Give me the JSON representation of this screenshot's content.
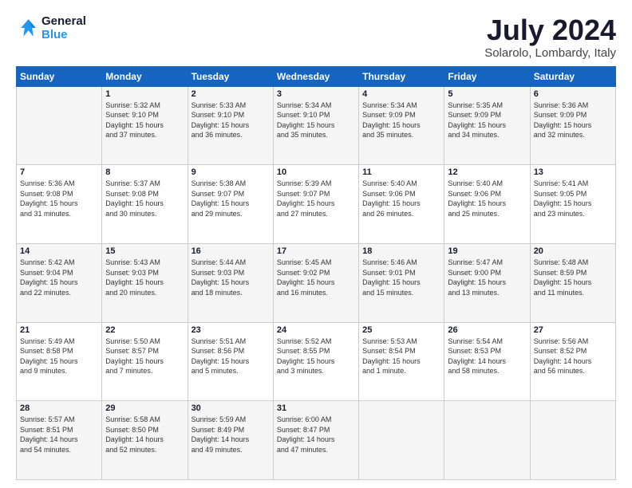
{
  "logo": {
    "line1": "General",
    "line2": "Blue"
  },
  "title": "July 2024",
  "subtitle": "Solarolo, Lombardy, Italy",
  "header_days": [
    "Sunday",
    "Monday",
    "Tuesday",
    "Wednesday",
    "Thursday",
    "Friday",
    "Saturday"
  ],
  "weeks": [
    [
      {
        "day": "",
        "info": ""
      },
      {
        "day": "1",
        "info": "Sunrise: 5:32 AM\nSunset: 9:10 PM\nDaylight: 15 hours\nand 37 minutes."
      },
      {
        "day": "2",
        "info": "Sunrise: 5:33 AM\nSunset: 9:10 PM\nDaylight: 15 hours\nand 36 minutes."
      },
      {
        "day": "3",
        "info": "Sunrise: 5:34 AM\nSunset: 9:10 PM\nDaylight: 15 hours\nand 35 minutes."
      },
      {
        "day": "4",
        "info": "Sunrise: 5:34 AM\nSunset: 9:09 PM\nDaylight: 15 hours\nand 35 minutes."
      },
      {
        "day": "5",
        "info": "Sunrise: 5:35 AM\nSunset: 9:09 PM\nDaylight: 15 hours\nand 34 minutes."
      },
      {
        "day": "6",
        "info": "Sunrise: 5:36 AM\nSunset: 9:09 PM\nDaylight: 15 hours\nand 32 minutes."
      }
    ],
    [
      {
        "day": "7",
        "info": "Sunrise: 5:36 AM\nSunset: 9:08 PM\nDaylight: 15 hours\nand 31 minutes."
      },
      {
        "day": "8",
        "info": "Sunrise: 5:37 AM\nSunset: 9:08 PM\nDaylight: 15 hours\nand 30 minutes."
      },
      {
        "day": "9",
        "info": "Sunrise: 5:38 AM\nSunset: 9:07 PM\nDaylight: 15 hours\nand 29 minutes."
      },
      {
        "day": "10",
        "info": "Sunrise: 5:39 AM\nSunset: 9:07 PM\nDaylight: 15 hours\nand 27 minutes."
      },
      {
        "day": "11",
        "info": "Sunrise: 5:40 AM\nSunset: 9:06 PM\nDaylight: 15 hours\nand 26 minutes."
      },
      {
        "day": "12",
        "info": "Sunrise: 5:40 AM\nSunset: 9:06 PM\nDaylight: 15 hours\nand 25 minutes."
      },
      {
        "day": "13",
        "info": "Sunrise: 5:41 AM\nSunset: 9:05 PM\nDaylight: 15 hours\nand 23 minutes."
      }
    ],
    [
      {
        "day": "14",
        "info": "Sunrise: 5:42 AM\nSunset: 9:04 PM\nDaylight: 15 hours\nand 22 minutes."
      },
      {
        "day": "15",
        "info": "Sunrise: 5:43 AM\nSunset: 9:03 PM\nDaylight: 15 hours\nand 20 minutes."
      },
      {
        "day": "16",
        "info": "Sunrise: 5:44 AM\nSunset: 9:03 PM\nDaylight: 15 hours\nand 18 minutes."
      },
      {
        "day": "17",
        "info": "Sunrise: 5:45 AM\nSunset: 9:02 PM\nDaylight: 15 hours\nand 16 minutes."
      },
      {
        "day": "18",
        "info": "Sunrise: 5:46 AM\nSunset: 9:01 PM\nDaylight: 15 hours\nand 15 minutes."
      },
      {
        "day": "19",
        "info": "Sunrise: 5:47 AM\nSunset: 9:00 PM\nDaylight: 15 hours\nand 13 minutes."
      },
      {
        "day": "20",
        "info": "Sunrise: 5:48 AM\nSunset: 8:59 PM\nDaylight: 15 hours\nand 11 minutes."
      }
    ],
    [
      {
        "day": "21",
        "info": "Sunrise: 5:49 AM\nSunset: 8:58 PM\nDaylight: 15 hours\nand 9 minutes."
      },
      {
        "day": "22",
        "info": "Sunrise: 5:50 AM\nSunset: 8:57 PM\nDaylight: 15 hours\nand 7 minutes."
      },
      {
        "day": "23",
        "info": "Sunrise: 5:51 AM\nSunset: 8:56 PM\nDaylight: 15 hours\nand 5 minutes."
      },
      {
        "day": "24",
        "info": "Sunrise: 5:52 AM\nSunset: 8:55 PM\nDaylight: 15 hours\nand 3 minutes."
      },
      {
        "day": "25",
        "info": "Sunrise: 5:53 AM\nSunset: 8:54 PM\nDaylight: 15 hours\nand 1 minute."
      },
      {
        "day": "26",
        "info": "Sunrise: 5:54 AM\nSunset: 8:53 PM\nDaylight: 14 hours\nand 58 minutes."
      },
      {
        "day": "27",
        "info": "Sunrise: 5:56 AM\nSunset: 8:52 PM\nDaylight: 14 hours\nand 56 minutes."
      }
    ],
    [
      {
        "day": "28",
        "info": "Sunrise: 5:57 AM\nSunset: 8:51 PM\nDaylight: 14 hours\nand 54 minutes."
      },
      {
        "day": "29",
        "info": "Sunrise: 5:58 AM\nSunset: 8:50 PM\nDaylight: 14 hours\nand 52 minutes."
      },
      {
        "day": "30",
        "info": "Sunrise: 5:59 AM\nSunset: 8:49 PM\nDaylight: 14 hours\nand 49 minutes."
      },
      {
        "day": "31",
        "info": "Sunrise: 6:00 AM\nSunset: 8:47 PM\nDaylight: 14 hours\nand 47 minutes."
      },
      {
        "day": "",
        "info": ""
      },
      {
        "day": "",
        "info": ""
      },
      {
        "day": "",
        "info": ""
      }
    ]
  ]
}
